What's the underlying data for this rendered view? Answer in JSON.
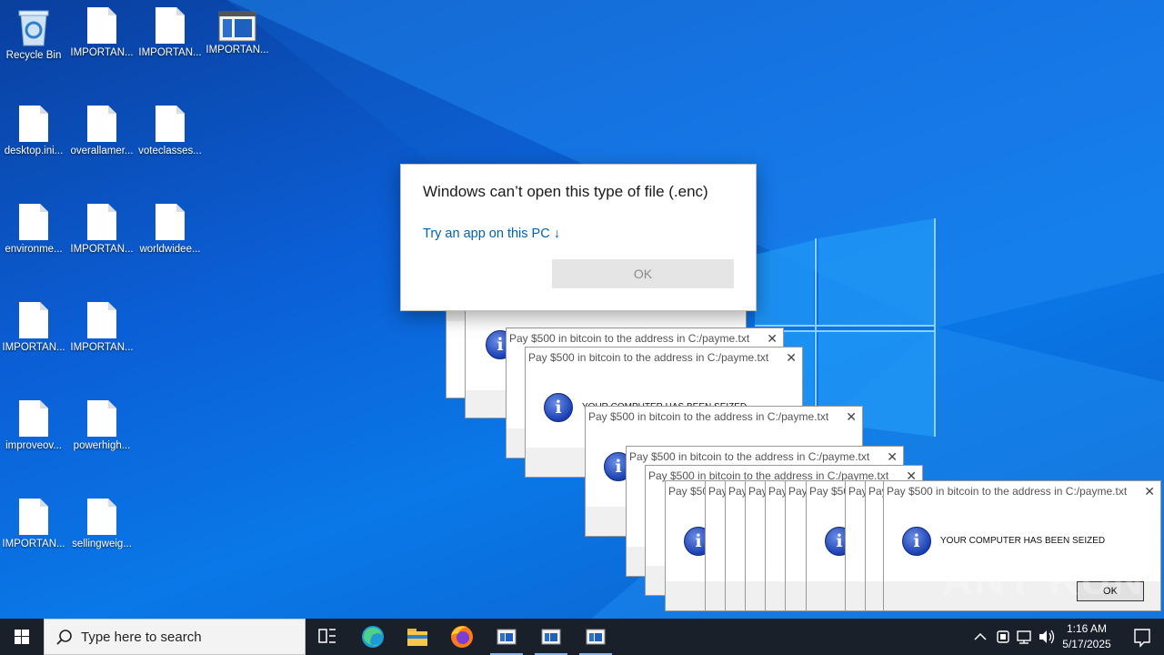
{
  "desktop": {
    "icons": [
      {
        "label": "Recycle Bin",
        "kind": "recycle-bin"
      },
      {
        "label": "IMPORTAN...",
        "kind": "file"
      },
      {
        "label": "IMPORTAN...",
        "kind": "file"
      },
      {
        "label": "IMPORTAN...",
        "kind": "app-window"
      },
      {
        "label": "desktop.ini...",
        "kind": "file"
      },
      {
        "label": "overallamer...",
        "kind": "file"
      },
      {
        "label": "voteclasses...",
        "kind": "file"
      },
      {
        "label": "environme...",
        "kind": "file"
      },
      {
        "label": "IMPORTAN...",
        "kind": "file"
      },
      {
        "label": "worldwidee...",
        "kind": "file"
      },
      {
        "label": "IMPORTAN...",
        "kind": "file"
      },
      {
        "label": "IMPORTAN...",
        "kind": "file"
      },
      {
        "label": "improveov...",
        "kind": "file"
      },
      {
        "label": "powerhigh...",
        "kind": "file"
      },
      {
        "label": "IMPORTAN...",
        "kind": "file"
      },
      {
        "label": "sellingweig...",
        "kind": "file"
      }
    ]
  },
  "open_with_dialog": {
    "title": "Windows can’t open this type of file (.enc)",
    "try_app_link": "Try an app on this PC ↓",
    "ok_label": "OK"
  },
  "ransom_box": {
    "caption": "Pay $500 in bitcoin to the address in C:/payme.txt",
    "message": "YOUR COMPUTER HAS BEEN SEIZED",
    "ok_label": "OK",
    "close_glyph": "✕"
  },
  "taskbar": {
    "search_placeholder": "Type here to search",
    "time": "1:16 AM",
    "date": "5/17/2025"
  },
  "watermark": "ANY RUN",
  "colors": {
    "desktop_accent": "#0b6fe0",
    "link": "#0063b1",
    "taskbar": "#1a2029"
  }
}
